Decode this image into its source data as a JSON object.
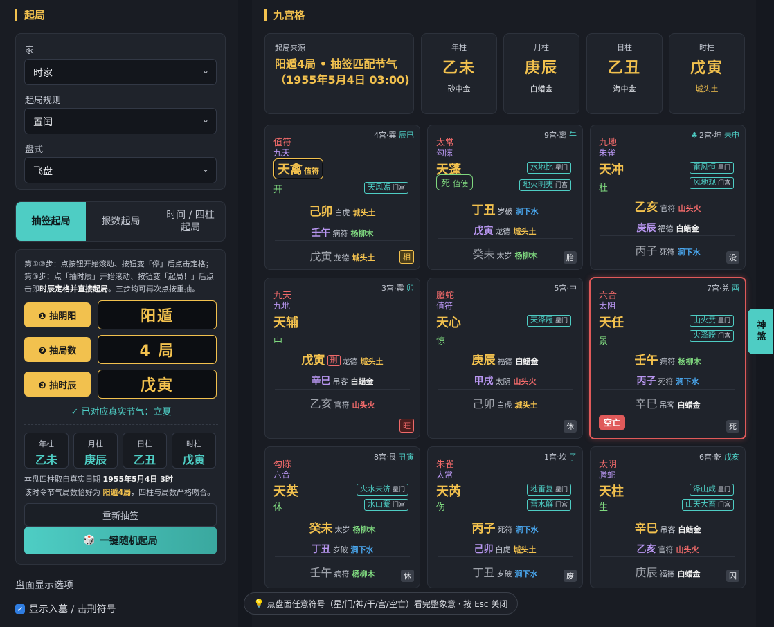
{
  "left": {
    "title": "起局",
    "fields": [
      {
        "label": "家",
        "value": "时家"
      },
      {
        "label": "起局规则",
        "value": "置闰"
      },
      {
        "label": "盘式",
        "value": "飞盘"
      }
    ],
    "tabs": [
      "抽签起局",
      "报数起局",
      "时间 / 四柱起局"
    ],
    "hint": {
      "line1": "第①②步：点按钮开始滚动、按钮变「停」后点击定格；",
      "line2": "第③步：点「抽时辰」开始滚动、按钮变「起局！」后点",
      "line3a": "击即",
      "line3b": "时辰定格并直接起局",
      "line3c": "。三步均可再次点按重抽。"
    },
    "draws": [
      {
        "label": "❶ 抽阴阳",
        "value": "阳遁"
      },
      {
        "label": "❷ 抽局数",
        "value": "4 局"
      },
      {
        "label": "❸ 抽时辰",
        "value": "戊寅"
      }
    ],
    "jieqi": "✓ 已对应真实节气：立夏",
    "mini_pillars": [
      {
        "title": "年柱",
        "value": "乙未"
      },
      {
        "title": "月柱",
        "value": "庚辰"
      },
      {
        "title": "日柱",
        "value": "乙丑"
      },
      {
        "title": "时柱",
        "value": "戊寅"
      }
    ],
    "note": {
      "a": "本盘四柱取自真实日期 ",
      "date": "1955年5月4日 3时",
      "b": "该时令节气局数恰好为 ",
      "ju": "阳遁4局",
      "c": "，四柱与局数严格吻合。"
    },
    "redraw": "重新抽签",
    "random": "一键随机起局",
    "options_title": "盘面显示选项",
    "checkbox": "显示入墓 / 击刑符号"
  },
  "right": {
    "title": "九宫格",
    "source": {
      "label": "起局来源",
      "value": "阳遁4局 • 抽签匹配节气（1955年5月4日 03:00)"
    },
    "pillars": [
      {
        "title": "年柱",
        "value": "乙未",
        "nayin": "砂中金",
        "color": "#ffffff"
      },
      {
        "title": "月柱",
        "value": "庚辰",
        "nayin": "白蜡金",
        "color": "#ffffff"
      },
      {
        "title": "日柱",
        "value": "乙丑",
        "nayin": "海中金",
        "color": "#ffffff"
      },
      {
        "title": "时柱",
        "value": "戊寅",
        "nayin": "城头土",
        "color": "#f2c14e"
      }
    ],
    "palaces": [
      {
        "hdr": "4宫·巽",
        "zhi": "辰巳",
        "god": "值符",
        "ctl": "九天",
        "star": "天禽",
        "star_sub": "值符",
        "door": "开",
        "tag1": "",
        "tag1m": "",
        "tag2": "天风姤",
        "tag2m": "门宫",
        "r1": "己卯",
        "r1s": "白虎",
        "r1e": "城头土",
        "r2": "壬午",
        "r2s": "病符",
        "r2e": "杨柳木",
        "r3": "戊寅",
        "r3s": "龙德",
        "r3e": "城头土",
        "state": "相"
      },
      {
        "hdr": "9宫·离",
        "zhi": "午",
        "god": "太常",
        "ctl": "勾陈",
        "star": "天蓬",
        "star_sub": "",
        "door": "死",
        "door_sub": "值使",
        "tag1": "水地比",
        "tag1m": "星门",
        "tag2": "地火明夷",
        "tag2m": "门宫",
        "r1": "丁丑",
        "r1s": "岁破",
        "r1e": "涧下水",
        "r2": "戊寅",
        "r2s": "龙德",
        "r2e": "城头土",
        "r3": "癸未",
        "r3s": "太岁",
        "r3e": "杨柳木",
        "state": "胎"
      },
      {
        "hdr": "2宫·坤",
        "zhi": "未申",
        "god": "九地",
        "ctl": "朱雀",
        "star": "天冲",
        "star_sub": "",
        "door": "杜",
        "tag1": "雷风恒",
        "tag1m": "星门",
        "tag2": "风地观",
        "tag2m": "门宫",
        "r1": "乙亥",
        "r1s": "官符",
        "r1e": "山头火",
        "r2": "庚辰",
        "r2s": "福德",
        "r2e": "白蜡金",
        "r3": "丙子",
        "r3s": "死符",
        "r3e": "涧下水",
        "state": "没"
      },
      {
        "hdr": "3宫·震",
        "zhi": "卯",
        "god": "九天",
        "ctl": "九地",
        "star": "天辅",
        "star_sub": "",
        "door": "中",
        "tag1": "",
        "tag1m": "",
        "tag2": "",
        "tag2m": "",
        "r1": "戊寅",
        "r1x": "刑",
        "r1s": "龙德",
        "r1e": "城头土",
        "r2": "辛巳",
        "r2s": "吊客",
        "r2e": "白蜡金",
        "r3": "乙亥",
        "r3s": "官符",
        "r3e": "山头火",
        "state": "旺"
      },
      {
        "hdr": "5宫·中",
        "zhi": "",
        "god": "螣蛇",
        "ctl": "值符",
        "star": "天心",
        "star_sub": "",
        "door": "惊",
        "tag1": "天泽履",
        "tag1m": "星门",
        "tag2": "",
        "tag2m": "",
        "r1": "庚辰",
        "r1s": "福德",
        "r1e": "白蜡金",
        "r2": "甲戌",
        "r2s": "太阴",
        "r2e": "山头火",
        "r3": "己卯",
        "r3s": "白虎",
        "r3e": "城头土",
        "state": "休"
      },
      {
        "hdr": "7宫·兑",
        "zhi": "酉",
        "god": "六合",
        "ctl": "太阴",
        "star": "天任",
        "star_sub": "",
        "door": "景",
        "tag1": "山火贲",
        "tag1m": "星门",
        "tag2": "火泽睽",
        "tag2m": "门宫",
        "r1": "壬午",
        "r1s": "病符",
        "r1e": "杨柳木",
        "r2": "丙子",
        "r2s": "死符",
        "r2e": "涧下水",
        "r3": "辛巳",
        "r3s": "吊客",
        "r3e": "白蜡金",
        "state": "死",
        "kong": "空亡"
      },
      {
        "hdr": "8宫·艮",
        "zhi": "丑寅",
        "god": "勾陈",
        "ctl": "六合",
        "star": "天英",
        "star_sub": "",
        "door": "休",
        "tag1": "火水未济",
        "tag1m": "星门",
        "tag2": "水山蹇",
        "tag2m": "门宫",
        "r1": "癸未",
        "r1s": "太岁",
        "r1e": "杨柳木",
        "r2": "丁丑",
        "r2s": "岁破",
        "r2e": "涧下水",
        "r3": "壬午",
        "r3s": "病符",
        "r3e": "杨柳木",
        "state": "休"
      },
      {
        "hdr": "1宫·坎",
        "zhi": "子",
        "god": "朱雀",
        "ctl": "太常",
        "star": "天芮",
        "star_sub": "",
        "door": "伤",
        "tag1": "地雷复",
        "tag1m": "星门",
        "tag2": "雷水解",
        "tag2m": "门宫",
        "r1": "丙子",
        "r1s": "死符",
        "r1e": "涧下水",
        "r2": "己卯",
        "r2s": "白虎",
        "r2e": "城头土",
        "r3": "丁丑",
        "r3s": "岁破",
        "r3e": "涧下水",
        "state": "废"
      },
      {
        "hdr": "6宫·乾",
        "zhi": "戌亥",
        "god": "太阴",
        "ctl": "螣蛇",
        "star": "天柱",
        "star_sub": "",
        "door": "生",
        "tag1": "泽山咸",
        "tag1m": "星门",
        "tag2": "山天大畜",
        "tag2m": "门宫",
        "r1": "辛巳",
        "r1s": "吊客",
        "r1e": "白蜡金",
        "r2": "乙亥",
        "r2s": "官符",
        "r2e": "山头火",
        "r3": "庚辰",
        "r3s": "福德",
        "r3e": "白蜡金",
        "state": "囚"
      }
    ]
  },
  "side_tab": "神煞",
  "toast": "点盘面任意符号（星/门/神/干/宫/空亡）看完整象意 · 按 Esc 关闭",
  "colors": {
    "accent": "#4ecdc4",
    "gold": "#f2c14e",
    "red": "#e05a5a"
  }
}
